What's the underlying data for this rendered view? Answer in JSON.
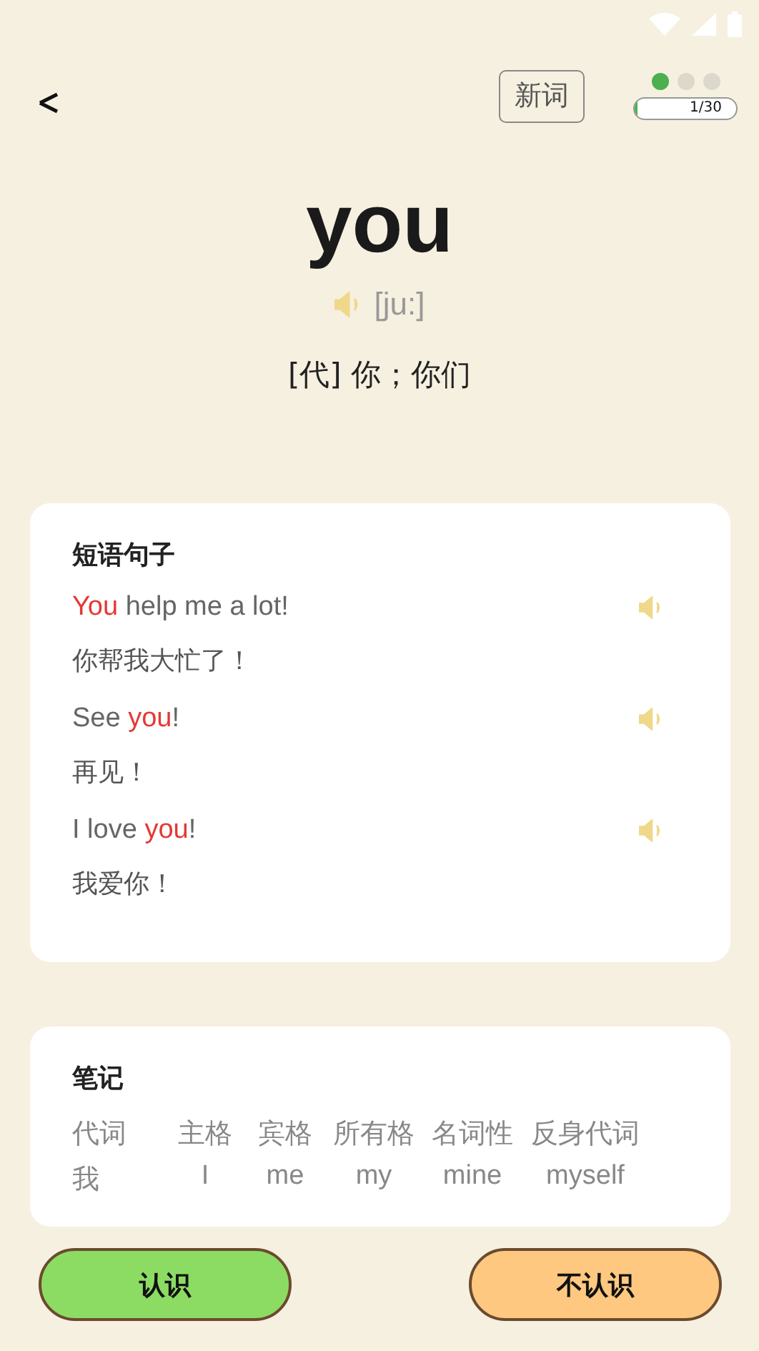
{
  "header": {
    "new_word_button": "新词",
    "progress_dots": [
      {
        "done": true
      },
      {
        "done": false
      },
      {
        "done": false
      }
    ],
    "progress": {
      "level": 0.033,
      "reading": "1/30"
    }
  },
  "word": {
    "text": "you",
    "phonetic": "[ju:]",
    "meaning": "[代] 你；你们"
  },
  "phrases": {
    "title": "短语句子",
    "items": [
      {
        "parts": [
          {
            "text": "You",
            "highlight": true
          },
          {
            "text": " help me a lot!",
            "highlight": false
          }
        ],
        "translation": "你帮我大忙了！"
      },
      {
        "parts": [
          {
            "text": "See ",
            "highlight": false
          },
          {
            "text": "you",
            "highlight": true
          },
          {
            "text": "!",
            "highlight": false
          }
        ],
        "translation": "再见！"
      },
      {
        "parts": [
          {
            "text": "I love ",
            "highlight": false
          },
          {
            "text": "you",
            "highlight": true
          },
          {
            "text": "!",
            "highlight": false
          }
        ],
        "translation": "我爱你！"
      }
    ]
  },
  "notes": {
    "title": "笔记",
    "rows": [
      [
        "代词",
        "主格",
        "宾格",
        "所有格",
        "名词性",
        "反身代词"
      ],
      [
        "我",
        "I",
        "me",
        "my",
        "mine",
        "myself"
      ]
    ]
  },
  "buttons": [
    {
      "label": "认识",
      "kind": "known"
    },
    {
      "label": "不认识",
      "kind": "unknown"
    }
  ]
}
